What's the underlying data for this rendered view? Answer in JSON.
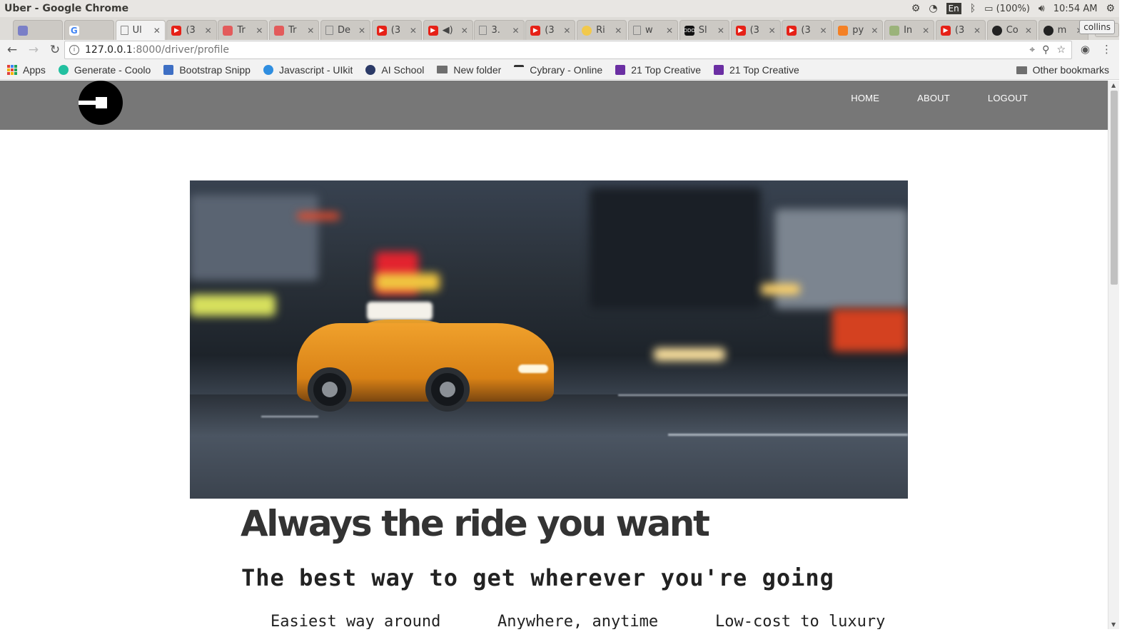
{
  "os": {
    "window_title": "Uber - Google Chrome",
    "input_lang": "En",
    "battery": "(100%)",
    "clock": "10:54 AM"
  },
  "tabs": [
    {
      "label": "",
      "icon": "mail-icon"
    },
    {
      "label": "",
      "icon": "google-icon"
    },
    {
      "label": "Ul",
      "icon": "doc-icon",
      "active": true
    },
    {
      "label": "(3",
      "icon": "youtube-icon"
    },
    {
      "label": "Tr",
      "icon": "red-app-icon"
    },
    {
      "label": "Tr",
      "icon": "red-app-icon"
    },
    {
      "label": "De",
      "icon": "doc-icon"
    },
    {
      "label": "(3",
      "icon": "youtube-icon"
    },
    {
      "label": "◀)",
      "icon": "youtube-icon"
    },
    {
      "label": "3.",
      "icon": "doc-icon"
    },
    {
      "label": "(3",
      "icon": "youtube-icon"
    },
    {
      "label": "Ri",
      "icon": "yellow-icon"
    },
    {
      "label": "w",
      "icon": "doc-icon"
    },
    {
      "label": "Sl",
      "icon": "ddo-icon"
    },
    {
      "label": "(3",
      "icon": "youtube-icon"
    },
    {
      "label": "(3",
      "icon": "youtube-icon"
    },
    {
      "label": "py",
      "icon": "stackoverflow-icon"
    },
    {
      "label": "In",
      "icon": "tree-icon"
    },
    {
      "label": "(3",
      "icon": "youtube-icon"
    },
    {
      "label": "Co",
      "icon": "github-icon"
    },
    {
      "label": "m",
      "icon": "github-icon"
    }
  ],
  "profile_name": "collins",
  "address": {
    "host": "127.0.0.1",
    "path": ":8000/driver/profile"
  },
  "bookmarks": {
    "apps": "Apps",
    "items": [
      {
        "label": "Generate - Coolo",
        "color": "#22c0a0"
      },
      {
        "label": "Bootstrap Snipp",
        "color": "#3e6fc4"
      },
      {
        "label": "Javascript - UIkit",
        "color": "#2f8ee0"
      },
      {
        "label": "AI School",
        "color": "#2b3a67"
      },
      {
        "label": "New folder",
        "color": "#6f6f6f"
      },
      {
        "label": "Cybrary - Online",
        "color": "#333333"
      },
      {
        "label": "21 Top Creative",
        "color": "#6b2fa3"
      },
      {
        "label": "21 Top Creative",
        "color": "#6b2fa3"
      }
    ],
    "other": "Other bookmarks"
  },
  "site": {
    "nav": {
      "home": "HOME",
      "about": "ABOUT",
      "logout": "LOGOUT"
    },
    "headline": "Always the ride you want",
    "subheadline": "The best way to get wherever you're going",
    "features": [
      "Easiest way around",
      "Anywhere, anytime",
      "Low-cost to luxury"
    ]
  },
  "colors": {
    "navbar": "#777777",
    "headline": "#333333"
  }
}
